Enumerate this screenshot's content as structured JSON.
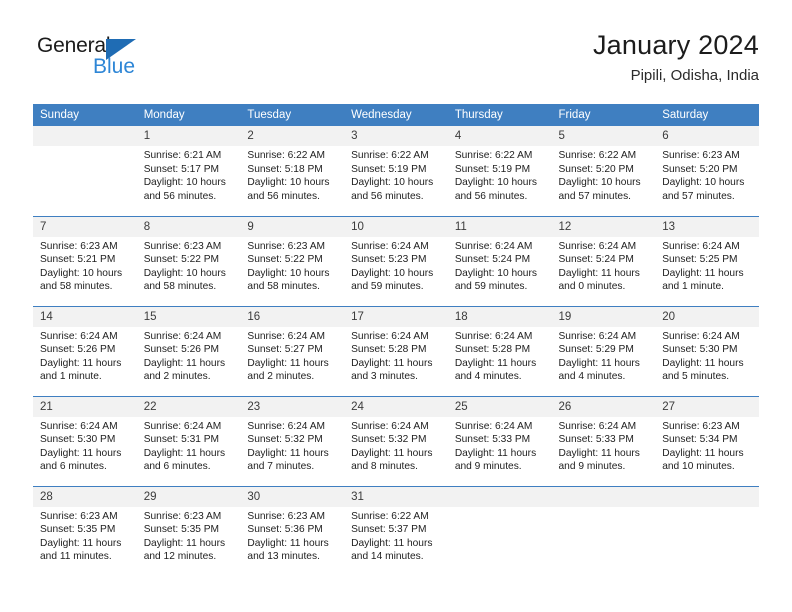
{
  "brand": {
    "word_general": "General",
    "word_blue": "Blue",
    "accent_blue": "#2e86d6",
    "triangle_blue": "#1f6cb4"
  },
  "header": {
    "title": "January 2024",
    "subtitle": "Pipili, Odisha, India",
    "header_bg": "#3f7fc1",
    "daynum_bg": "#f2f2f2"
  },
  "weekdays": [
    "Sunday",
    "Monday",
    "Tuesday",
    "Wednesday",
    "Thursday",
    "Friday",
    "Saturday"
  ],
  "weeks": [
    [
      {
        "day": "",
        "sunrise": "",
        "sunset": "",
        "daylight1": "",
        "daylight2": ""
      },
      {
        "day": "1",
        "sunrise": "Sunrise: 6:21 AM",
        "sunset": "Sunset: 5:17 PM",
        "daylight1": "Daylight: 10 hours",
        "daylight2": "and 56 minutes."
      },
      {
        "day": "2",
        "sunrise": "Sunrise: 6:22 AM",
        "sunset": "Sunset: 5:18 PM",
        "daylight1": "Daylight: 10 hours",
        "daylight2": "and 56 minutes."
      },
      {
        "day": "3",
        "sunrise": "Sunrise: 6:22 AM",
        "sunset": "Sunset: 5:19 PM",
        "daylight1": "Daylight: 10 hours",
        "daylight2": "and 56 minutes."
      },
      {
        "day": "4",
        "sunrise": "Sunrise: 6:22 AM",
        "sunset": "Sunset: 5:19 PM",
        "daylight1": "Daylight: 10 hours",
        "daylight2": "and 56 minutes."
      },
      {
        "day": "5",
        "sunrise": "Sunrise: 6:22 AM",
        "sunset": "Sunset: 5:20 PM",
        "daylight1": "Daylight: 10 hours",
        "daylight2": "and 57 minutes."
      },
      {
        "day": "6",
        "sunrise": "Sunrise: 6:23 AM",
        "sunset": "Sunset: 5:20 PM",
        "daylight1": "Daylight: 10 hours",
        "daylight2": "and 57 minutes."
      }
    ],
    [
      {
        "day": "7",
        "sunrise": "Sunrise: 6:23 AM",
        "sunset": "Sunset: 5:21 PM",
        "daylight1": "Daylight: 10 hours",
        "daylight2": "and 58 minutes."
      },
      {
        "day": "8",
        "sunrise": "Sunrise: 6:23 AM",
        "sunset": "Sunset: 5:22 PM",
        "daylight1": "Daylight: 10 hours",
        "daylight2": "and 58 minutes."
      },
      {
        "day": "9",
        "sunrise": "Sunrise: 6:23 AM",
        "sunset": "Sunset: 5:22 PM",
        "daylight1": "Daylight: 10 hours",
        "daylight2": "and 58 minutes."
      },
      {
        "day": "10",
        "sunrise": "Sunrise: 6:24 AM",
        "sunset": "Sunset: 5:23 PM",
        "daylight1": "Daylight: 10 hours",
        "daylight2": "and 59 minutes."
      },
      {
        "day": "11",
        "sunrise": "Sunrise: 6:24 AM",
        "sunset": "Sunset: 5:24 PM",
        "daylight1": "Daylight: 10 hours",
        "daylight2": "and 59 minutes."
      },
      {
        "day": "12",
        "sunrise": "Sunrise: 6:24 AM",
        "sunset": "Sunset: 5:24 PM",
        "daylight1": "Daylight: 11 hours",
        "daylight2": "and 0 minutes."
      },
      {
        "day": "13",
        "sunrise": "Sunrise: 6:24 AM",
        "sunset": "Sunset: 5:25 PM",
        "daylight1": "Daylight: 11 hours",
        "daylight2": "and 1 minute."
      }
    ],
    [
      {
        "day": "14",
        "sunrise": "Sunrise: 6:24 AM",
        "sunset": "Sunset: 5:26 PM",
        "daylight1": "Daylight: 11 hours",
        "daylight2": "and 1 minute."
      },
      {
        "day": "15",
        "sunrise": "Sunrise: 6:24 AM",
        "sunset": "Sunset: 5:26 PM",
        "daylight1": "Daylight: 11 hours",
        "daylight2": "and 2 minutes."
      },
      {
        "day": "16",
        "sunrise": "Sunrise: 6:24 AM",
        "sunset": "Sunset: 5:27 PM",
        "daylight1": "Daylight: 11 hours",
        "daylight2": "and 2 minutes."
      },
      {
        "day": "17",
        "sunrise": "Sunrise: 6:24 AM",
        "sunset": "Sunset: 5:28 PM",
        "daylight1": "Daylight: 11 hours",
        "daylight2": "and 3 minutes."
      },
      {
        "day": "18",
        "sunrise": "Sunrise: 6:24 AM",
        "sunset": "Sunset: 5:28 PM",
        "daylight1": "Daylight: 11 hours",
        "daylight2": "and 4 minutes."
      },
      {
        "day": "19",
        "sunrise": "Sunrise: 6:24 AM",
        "sunset": "Sunset: 5:29 PM",
        "daylight1": "Daylight: 11 hours",
        "daylight2": "and 4 minutes."
      },
      {
        "day": "20",
        "sunrise": "Sunrise: 6:24 AM",
        "sunset": "Sunset: 5:30 PM",
        "daylight1": "Daylight: 11 hours",
        "daylight2": "and 5 minutes."
      }
    ],
    [
      {
        "day": "21",
        "sunrise": "Sunrise: 6:24 AM",
        "sunset": "Sunset: 5:30 PM",
        "daylight1": "Daylight: 11 hours",
        "daylight2": "and 6 minutes."
      },
      {
        "day": "22",
        "sunrise": "Sunrise: 6:24 AM",
        "sunset": "Sunset: 5:31 PM",
        "daylight1": "Daylight: 11 hours",
        "daylight2": "and 6 minutes."
      },
      {
        "day": "23",
        "sunrise": "Sunrise: 6:24 AM",
        "sunset": "Sunset: 5:32 PM",
        "daylight1": "Daylight: 11 hours",
        "daylight2": "and 7 minutes."
      },
      {
        "day": "24",
        "sunrise": "Sunrise: 6:24 AM",
        "sunset": "Sunset: 5:32 PM",
        "daylight1": "Daylight: 11 hours",
        "daylight2": "and 8 minutes."
      },
      {
        "day": "25",
        "sunrise": "Sunrise: 6:24 AM",
        "sunset": "Sunset: 5:33 PM",
        "daylight1": "Daylight: 11 hours",
        "daylight2": "and 9 minutes."
      },
      {
        "day": "26",
        "sunrise": "Sunrise: 6:24 AM",
        "sunset": "Sunset: 5:33 PM",
        "daylight1": "Daylight: 11 hours",
        "daylight2": "and 9 minutes."
      },
      {
        "day": "27",
        "sunrise": "Sunrise: 6:23 AM",
        "sunset": "Sunset: 5:34 PM",
        "daylight1": "Daylight: 11 hours",
        "daylight2": "and 10 minutes."
      }
    ],
    [
      {
        "day": "28",
        "sunrise": "Sunrise: 6:23 AM",
        "sunset": "Sunset: 5:35 PM",
        "daylight1": "Daylight: 11 hours",
        "daylight2": "and 11 minutes."
      },
      {
        "day": "29",
        "sunrise": "Sunrise: 6:23 AM",
        "sunset": "Sunset: 5:35 PM",
        "daylight1": "Daylight: 11 hours",
        "daylight2": "and 12 minutes."
      },
      {
        "day": "30",
        "sunrise": "Sunrise: 6:23 AM",
        "sunset": "Sunset: 5:36 PM",
        "daylight1": "Daylight: 11 hours",
        "daylight2": "and 13 minutes."
      },
      {
        "day": "31",
        "sunrise": "Sunrise: 6:22 AM",
        "sunset": "Sunset: 5:37 PM",
        "daylight1": "Daylight: 11 hours",
        "daylight2": "and 14 minutes."
      },
      {
        "day": "",
        "sunrise": "",
        "sunset": "",
        "daylight1": "",
        "daylight2": ""
      },
      {
        "day": "",
        "sunrise": "",
        "sunset": "",
        "daylight1": "",
        "daylight2": ""
      },
      {
        "day": "",
        "sunrise": "",
        "sunset": "",
        "daylight1": "",
        "daylight2": ""
      }
    ]
  ]
}
